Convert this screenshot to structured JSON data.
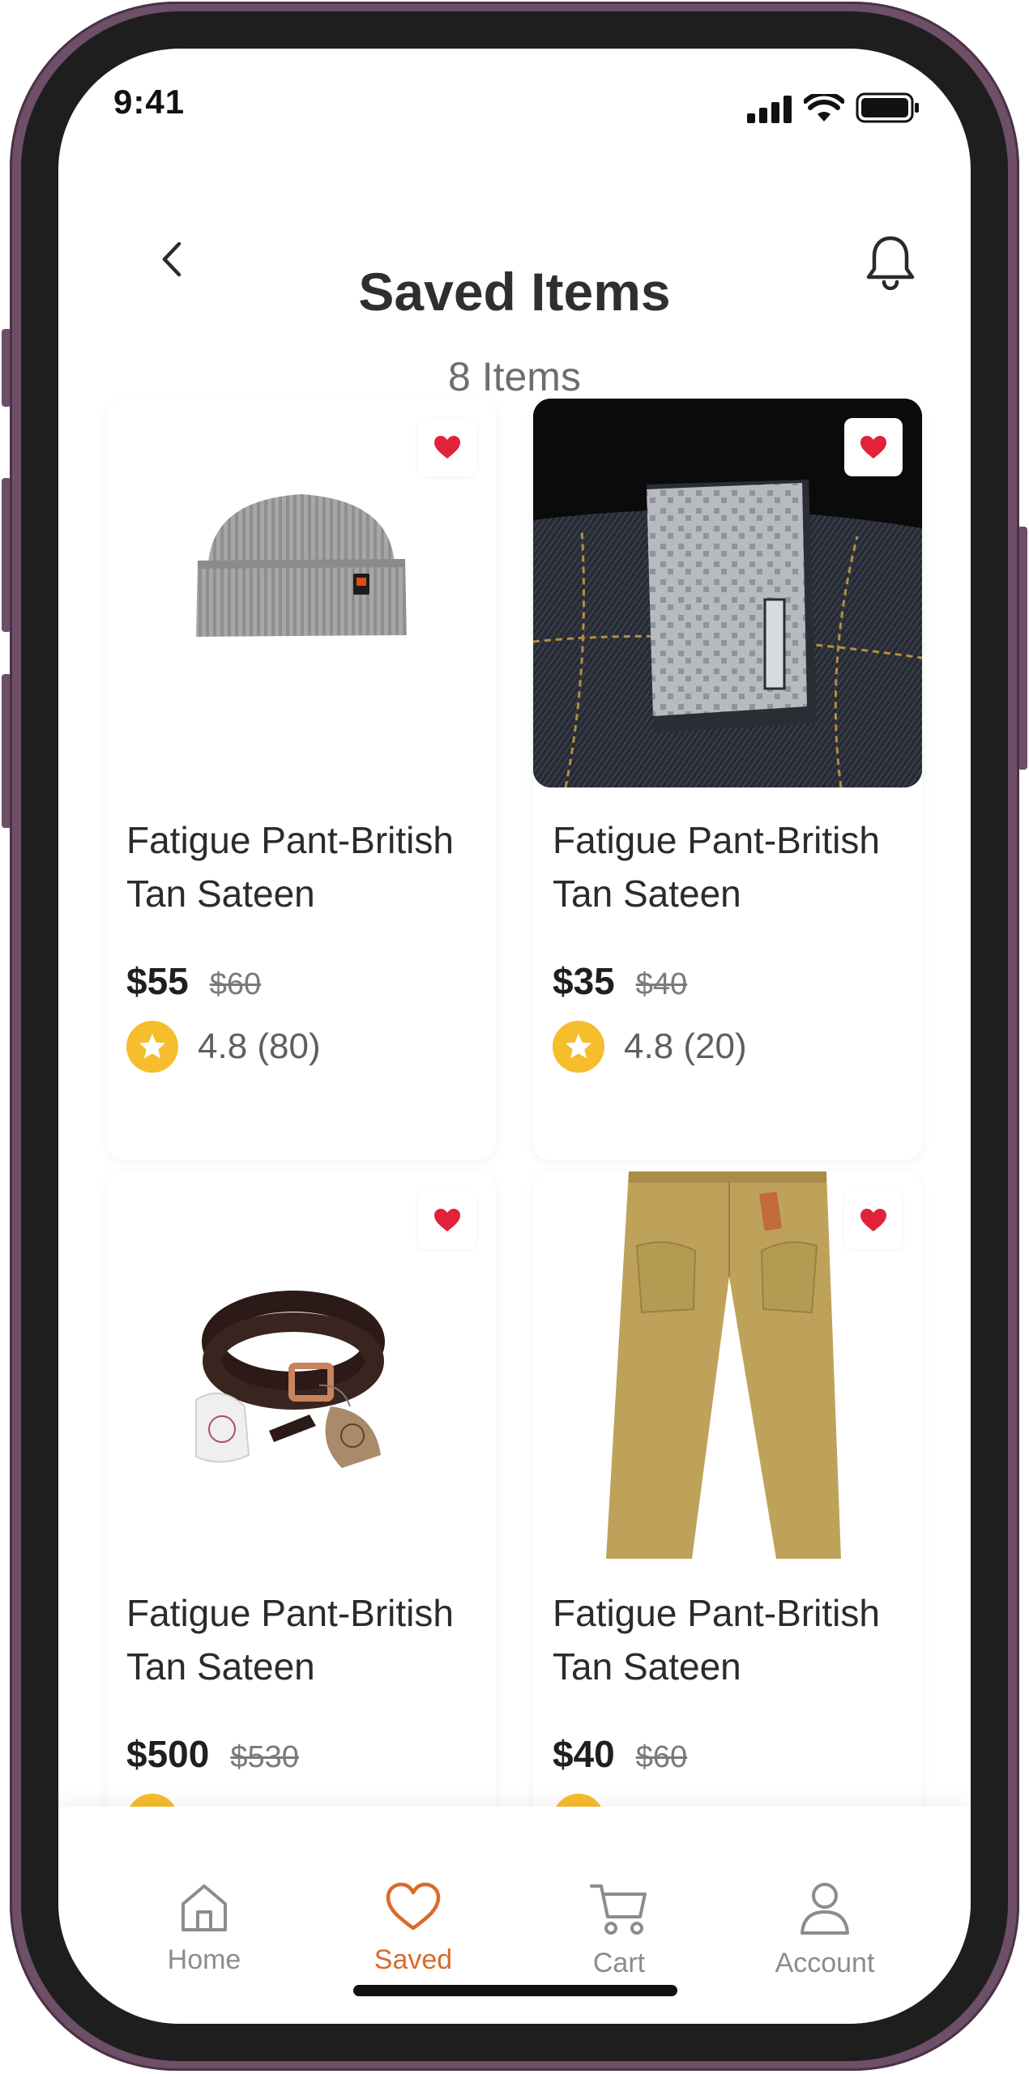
{
  "status_bar": {
    "time": "9:41"
  },
  "header": {
    "title": "Saved Items",
    "subtitle": "8 Items"
  },
  "products": [
    {
      "name": "Fatigue Pant-British Tan Sateen",
      "price": "$55",
      "old_price": "$60",
      "rating": "4.8 (80)",
      "image": "grey-beanie"
    },
    {
      "name": "Fatigue Pant-British Tan Sateen",
      "price": "$35",
      "old_price": "$40",
      "rating": "4.8 (20)",
      "image": "card-deck-on-denim"
    },
    {
      "name": "Fatigue Pant-British Tan Sateen",
      "price": "$500",
      "old_price": "$530",
      "rating": "",
      "image": "leather-belt"
    },
    {
      "name": "Fatigue Pant-British Tan Sateen",
      "price": "$40",
      "old_price": "$60",
      "rating": "",
      "image": "tan-pants"
    }
  ],
  "nav": {
    "items": [
      {
        "label": "Home",
        "icon": "home-icon",
        "active": false
      },
      {
        "label": "Saved",
        "icon": "heart-icon",
        "active": true
      },
      {
        "label": "Cart",
        "icon": "cart-icon",
        "active": false
      },
      {
        "label": "Account",
        "icon": "user-icon",
        "active": false
      }
    ]
  },
  "colors": {
    "accent": "#d96a2a",
    "heart": "#e0223b",
    "star": "#f6bd2c",
    "frame": "#6d4f68"
  }
}
